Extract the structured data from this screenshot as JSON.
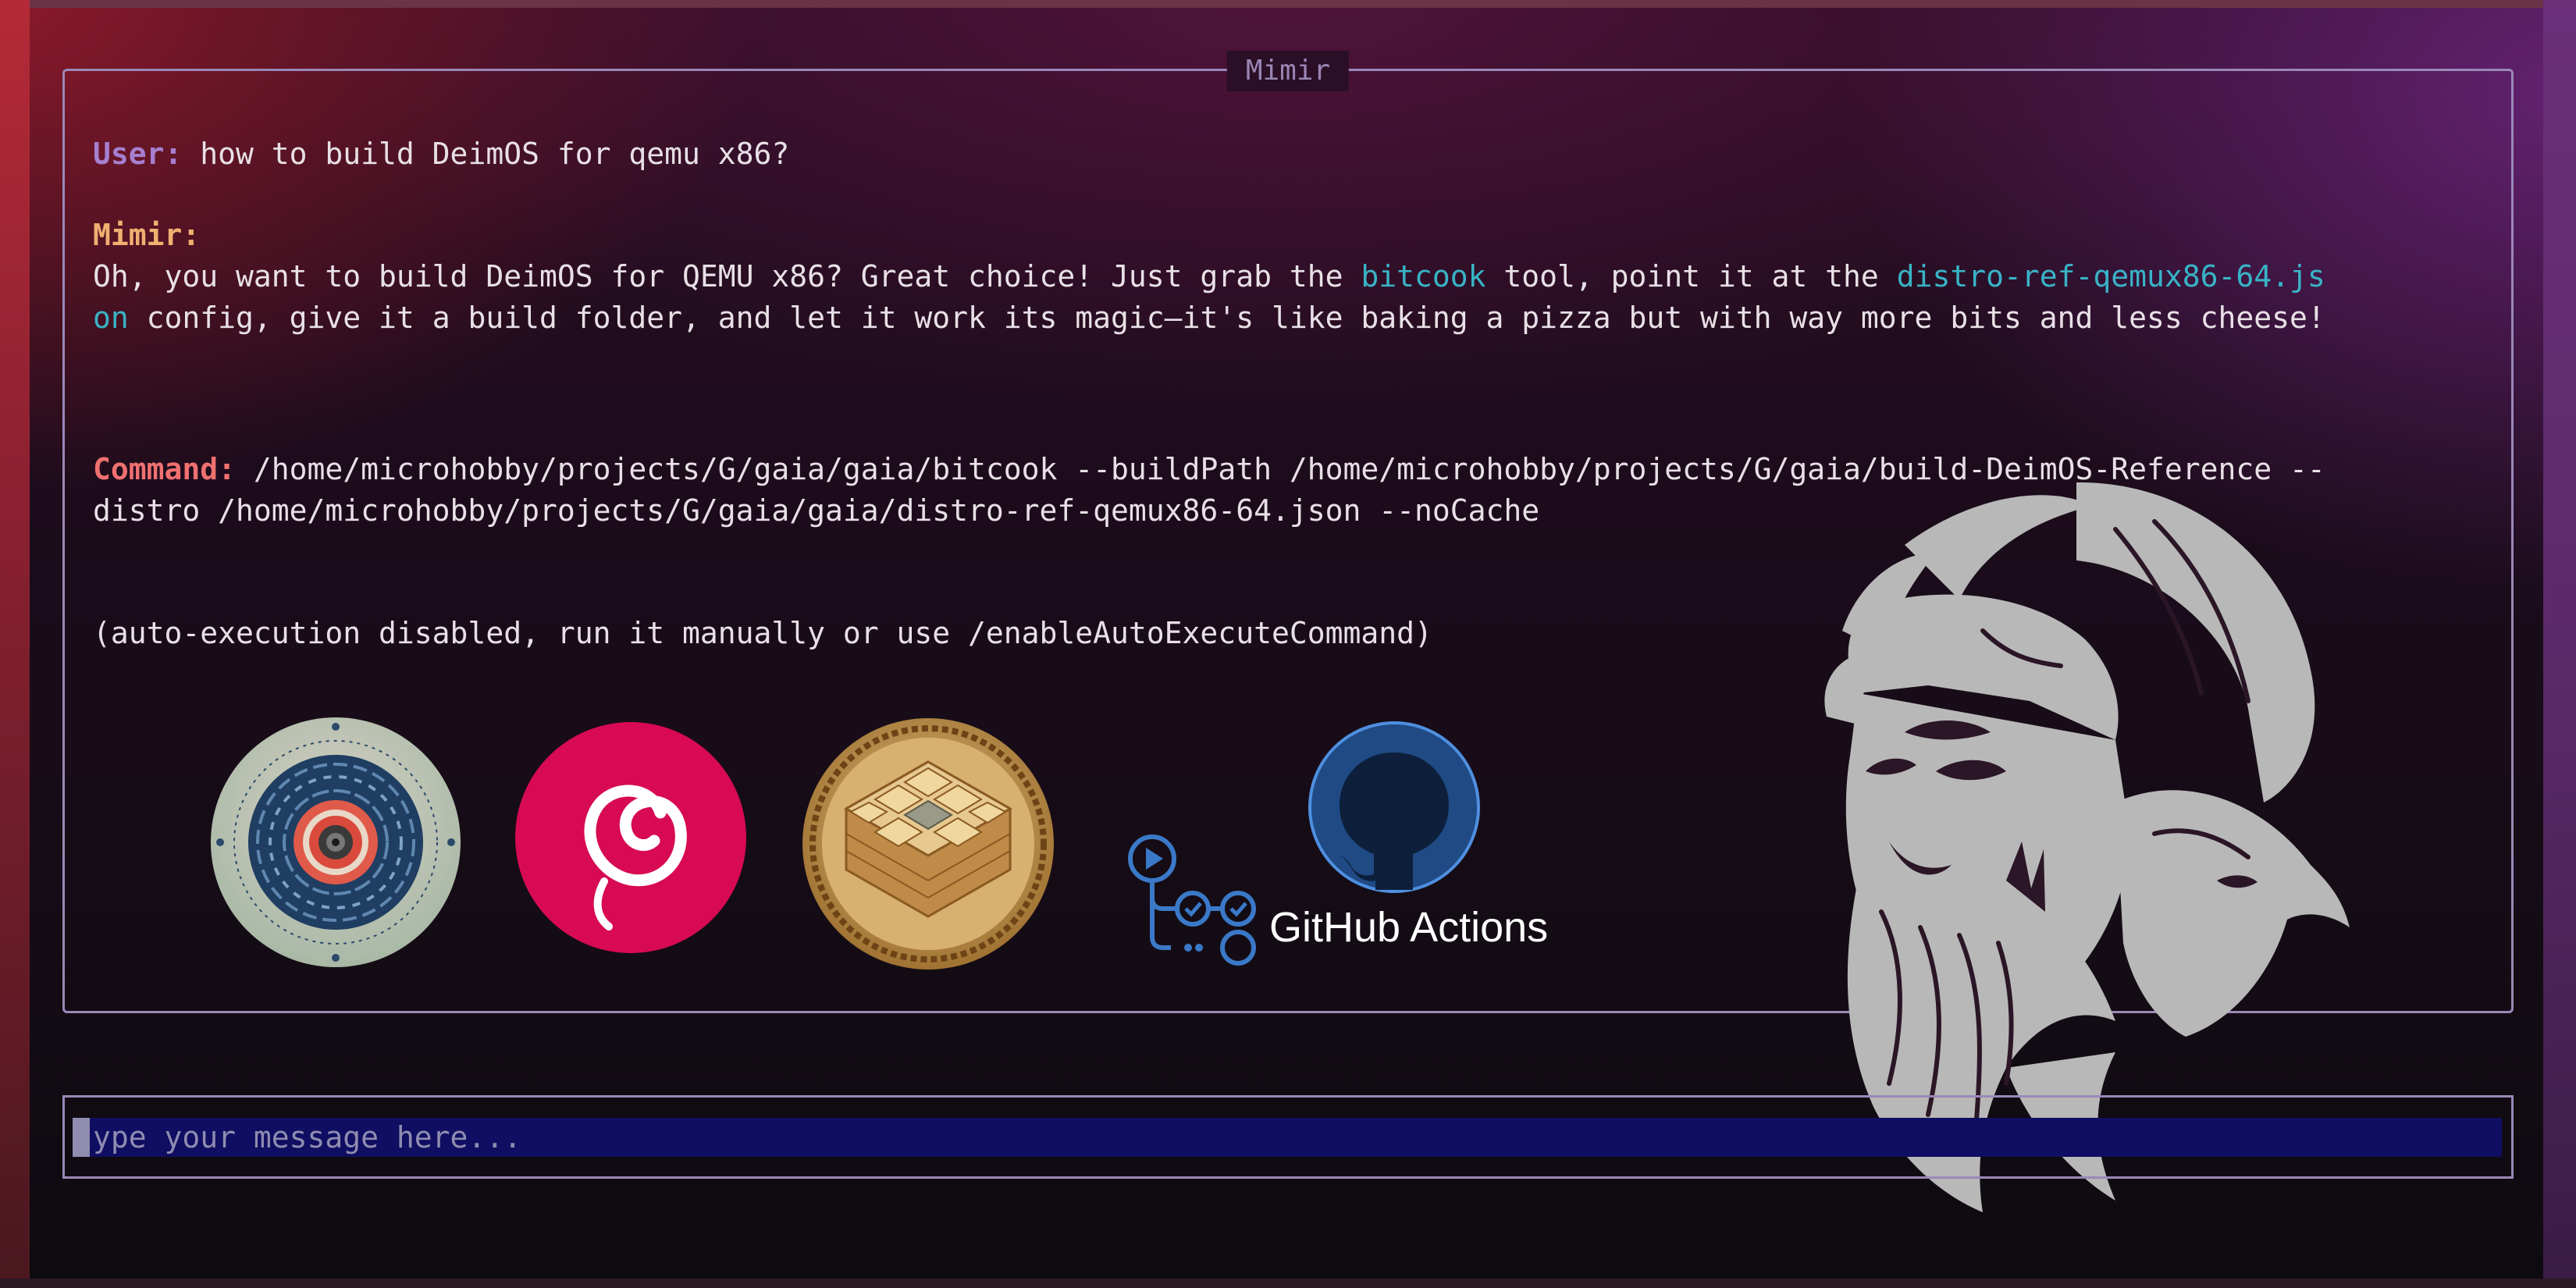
{
  "window": {
    "title": "Mimir"
  },
  "conversation": {
    "user": {
      "label": "User:",
      "text": " how to build DeimOS for qemu x86?"
    },
    "assistant": {
      "label": "Mimir:",
      "line1_pre": "Oh, you want to build DeimOS for QEMU x86? Great choice! Just grab the ",
      "tool_name": "bitcook",
      "line1_mid": " tool, point it at the ",
      "config_part1": "distro-ref-qemux86-64.js",
      "config_part2": "on",
      "line2_post": " config, give it a build folder, and let it work its magic—it's like baking a pizza but with way more bits and less cheese!"
    },
    "command": {
      "label": "Command:",
      "line1": " /home/microhobby/projects/G/gaia/gaia/bitcook --buildPath /home/microhobby/projects/G/gaia/build-DeimOS-Reference --",
      "line2": "distro /home/microhobby/projects/G/gaia/gaia/distro-ref-qemux86-64.json --noCache"
    },
    "notice": "(auto-execution disabled, run it manually or use /enableAutoExecuteCommand)"
  },
  "logos": {
    "items": [
      "concentric-disc-logo",
      "debian-swirl-logo",
      "bitcook-grid-logo",
      "github-actions-logo",
      "odin-raven-art"
    ],
    "github_actions_text": "GitHub Actions"
  },
  "input": {
    "placeholder": "ype your message here...",
    "value": ""
  },
  "colors": {
    "user_label": "#a77fd0",
    "mimir_label": "#f0b070",
    "command_label": "#f07070",
    "highlight": "#39b3c6",
    "text": "#e8e0e6",
    "border": "#9a88b8",
    "input_bg": "#0f0e62",
    "debian_red": "#d70a53",
    "github_blue": "#3a79c8"
  }
}
